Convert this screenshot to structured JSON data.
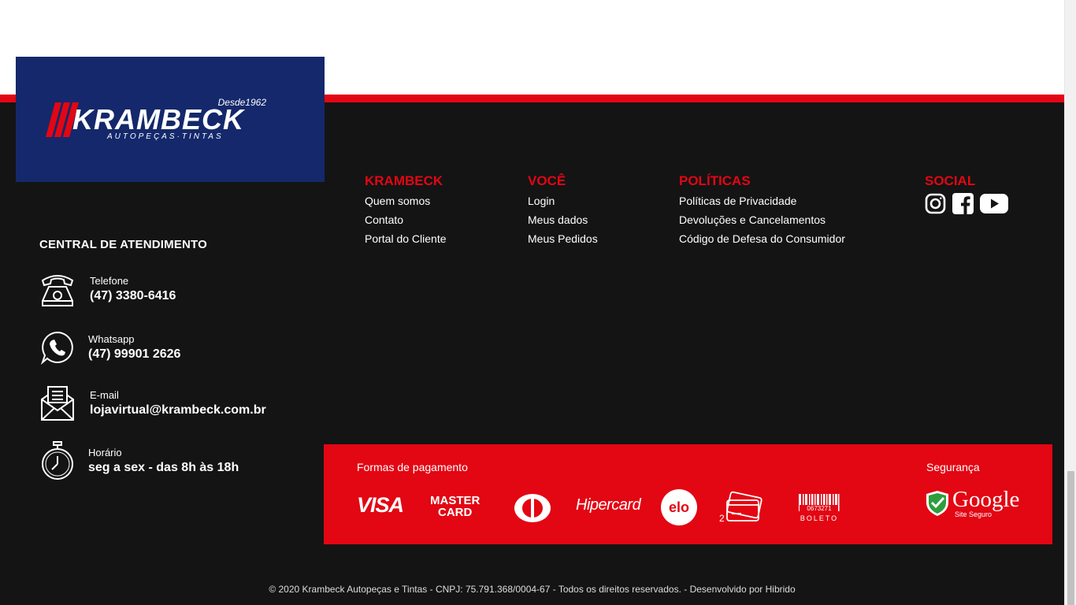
{
  "logo": {
    "brand": "KRAMBECK",
    "since": "Desde1962",
    "tagline": "AUTOPEÇAS·TINTAS"
  },
  "central": {
    "title": "CENTRAL DE ATENDIMENTO",
    "items": [
      {
        "label": "Telefone",
        "value": "(47) 3380-6416",
        "icon": "telephone-icon"
      },
      {
        "label": "Whatsapp",
        "value": "(47) 99901 2626",
        "icon": "whatsapp-icon"
      },
      {
        "label": "E-mail",
        "value": "lojavirtual@krambeck.com.br",
        "icon": "email-icon"
      },
      {
        "label": "Horário",
        "value": "seg a sex - das 8h às 18h",
        "icon": "stopwatch-icon"
      }
    ]
  },
  "columns": {
    "krambeck": {
      "title": "KRAMBECK",
      "links": [
        "Quem somos",
        "Contato",
        "Portal do Cliente"
      ]
    },
    "voce": {
      "title": "VOCÊ",
      "links": [
        "Login",
        "Meus dados",
        "Meus Pedidos"
      ]
    },
    "politicas": {
      "title": "POLÍTICAS",
      "links": [
        "Políticas de Privacidade",
        "Devoluções e Cancelamentos",
        "Código de Defesa do Consumidor"
      ]
    },
    "social": {
      "title": "SOCIAL",
      "icons": [
        "instagram-icon",
        "facebook-icon",
        "youtube-icon"
      ]
    }
  },
  "payment": {
    "title": "Formas de pagamento",
    "methods": {
      "visa": "VISA",
      "master_line1": "MASTER",
      "master_line2": "CARD",
      "hipercard": "Hipercard",
      "elo": "elo",
      "installments": "2",
      "boleto_number": "0673271",
      "boleto": "BOLETO"
    }
  },
  "security": {
    "title": "Segurança",
    "google": "Google",
    "site_seguro": "Site Seguro"
  },
  "copyright": "© 2020 Krambeck Autopeças e Tintas - CNPJ: 75.791.368/0004-67 - Todos os direitos reservados. - Desenvolvido por Hibrido",
  "colors": {
    "red": "#e30613",
    "navy": "#14286b",
    "dark": "#141414"
  }
}
